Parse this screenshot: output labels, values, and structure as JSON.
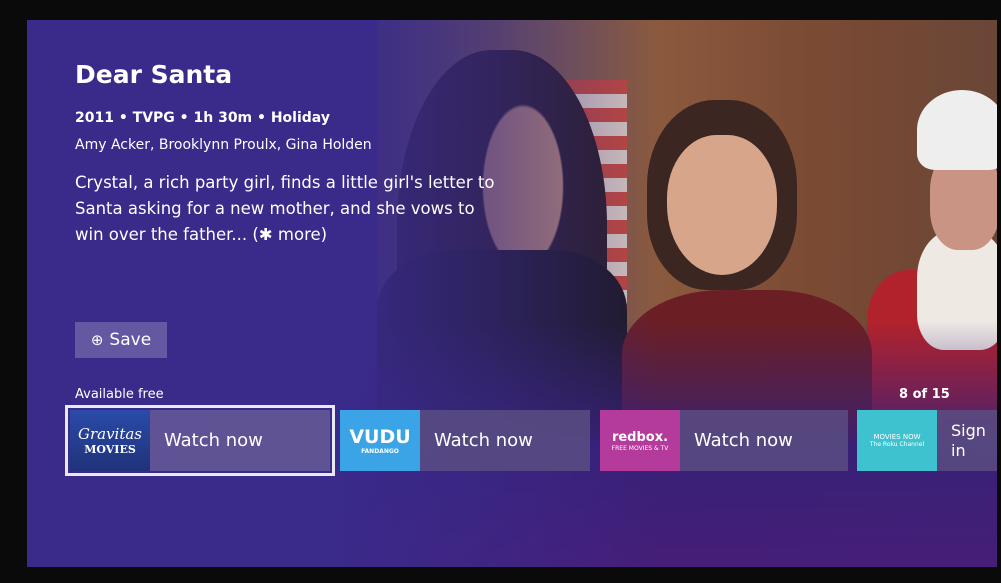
{
  "movie": {
    "title": "Dear Santa",
    "meta": "2011 • TVPG • 1h 30m • Holiday",
    "cast": "Amy Acker, Brooklynn Proulx, Gina Holden",
    "description": "Crystal, a rich party girl, finds a little girl's letter to Santa asking for a new mother, and she vows to win over the father... (✱ more)"
  },
  "actions": {
    "save_label": "Save",
    "save_icon": "plus-circle-icon"
  },
  "availability": {
    "heading": "Available free",
    "counter": "8 of 15"
  },
  "providers": [
    {
      "logo_line1": "Gravitas",
      "logo_line2": "MOVIES",
      "label": "Watch now"
    },
    {
      "logo_line1": "VUDU",
      "logo_line2": "FANDANGO",
      "label": "Watch now"
    },
    {
      "logo_line1": "redbox.",
      "logo_line2": "FREE MOVIES & TV",
      "label": "Watch now"
    },
    {
      "logo_line1": "MOVIES NOW",
      "logo_line2": "The Roku Channel",
      "label": "Sign in subsc"
    }
  ],
  "colors": {
    "background": "#3a2a8a",
    "focus_outline": "#e8e8f0",
    "vudu": "#3aa4e6",
    "redbox": "#b43a9b",
    "hallmark": "#3fc2cf"
  }
}
